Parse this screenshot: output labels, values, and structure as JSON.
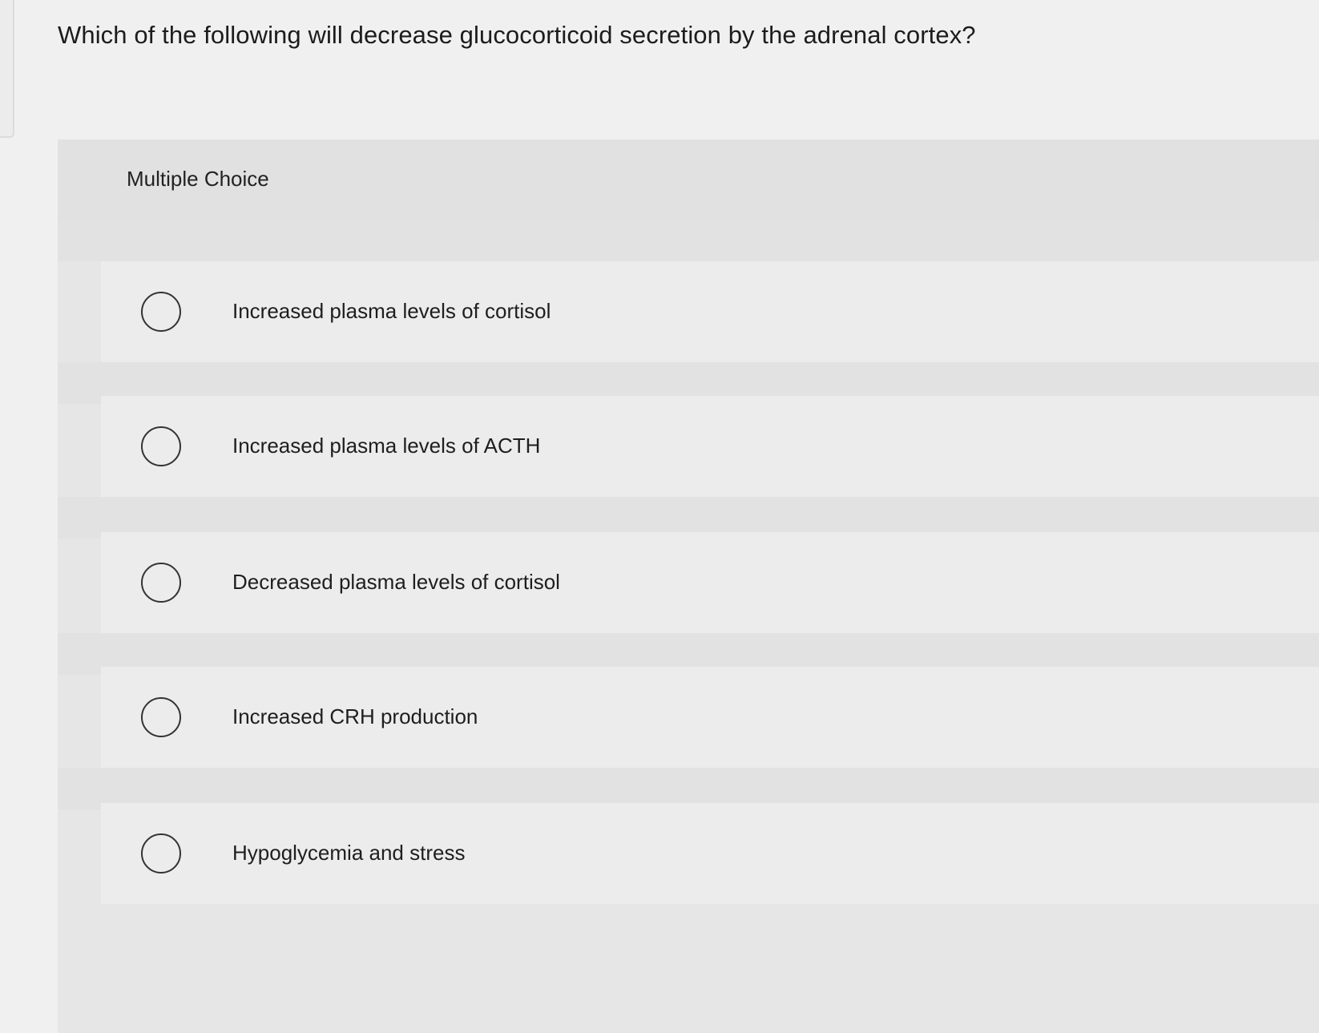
{
  "question": {
    "text": "Which of the following will decrease glucocorticoid secretion by the adrenal cortex?"
  },
  "question_type": "Multiple Choice",
  "options": [
    {
      "label": "Increased plasma levels of cortisol",
      "selected": false
    },
    {
      "label": "Increased plasma levels of ACTH",
      "selected": false
    },
    {
      "label": "Decreased plasma levels of cortisol",
      "selected": false
    },
    {
      "label": "Increased CRH production",
      "selected": false
    },
    {
      "label": "Hypoglycemia and stress",
      "selected": false
    }
  ]
}
